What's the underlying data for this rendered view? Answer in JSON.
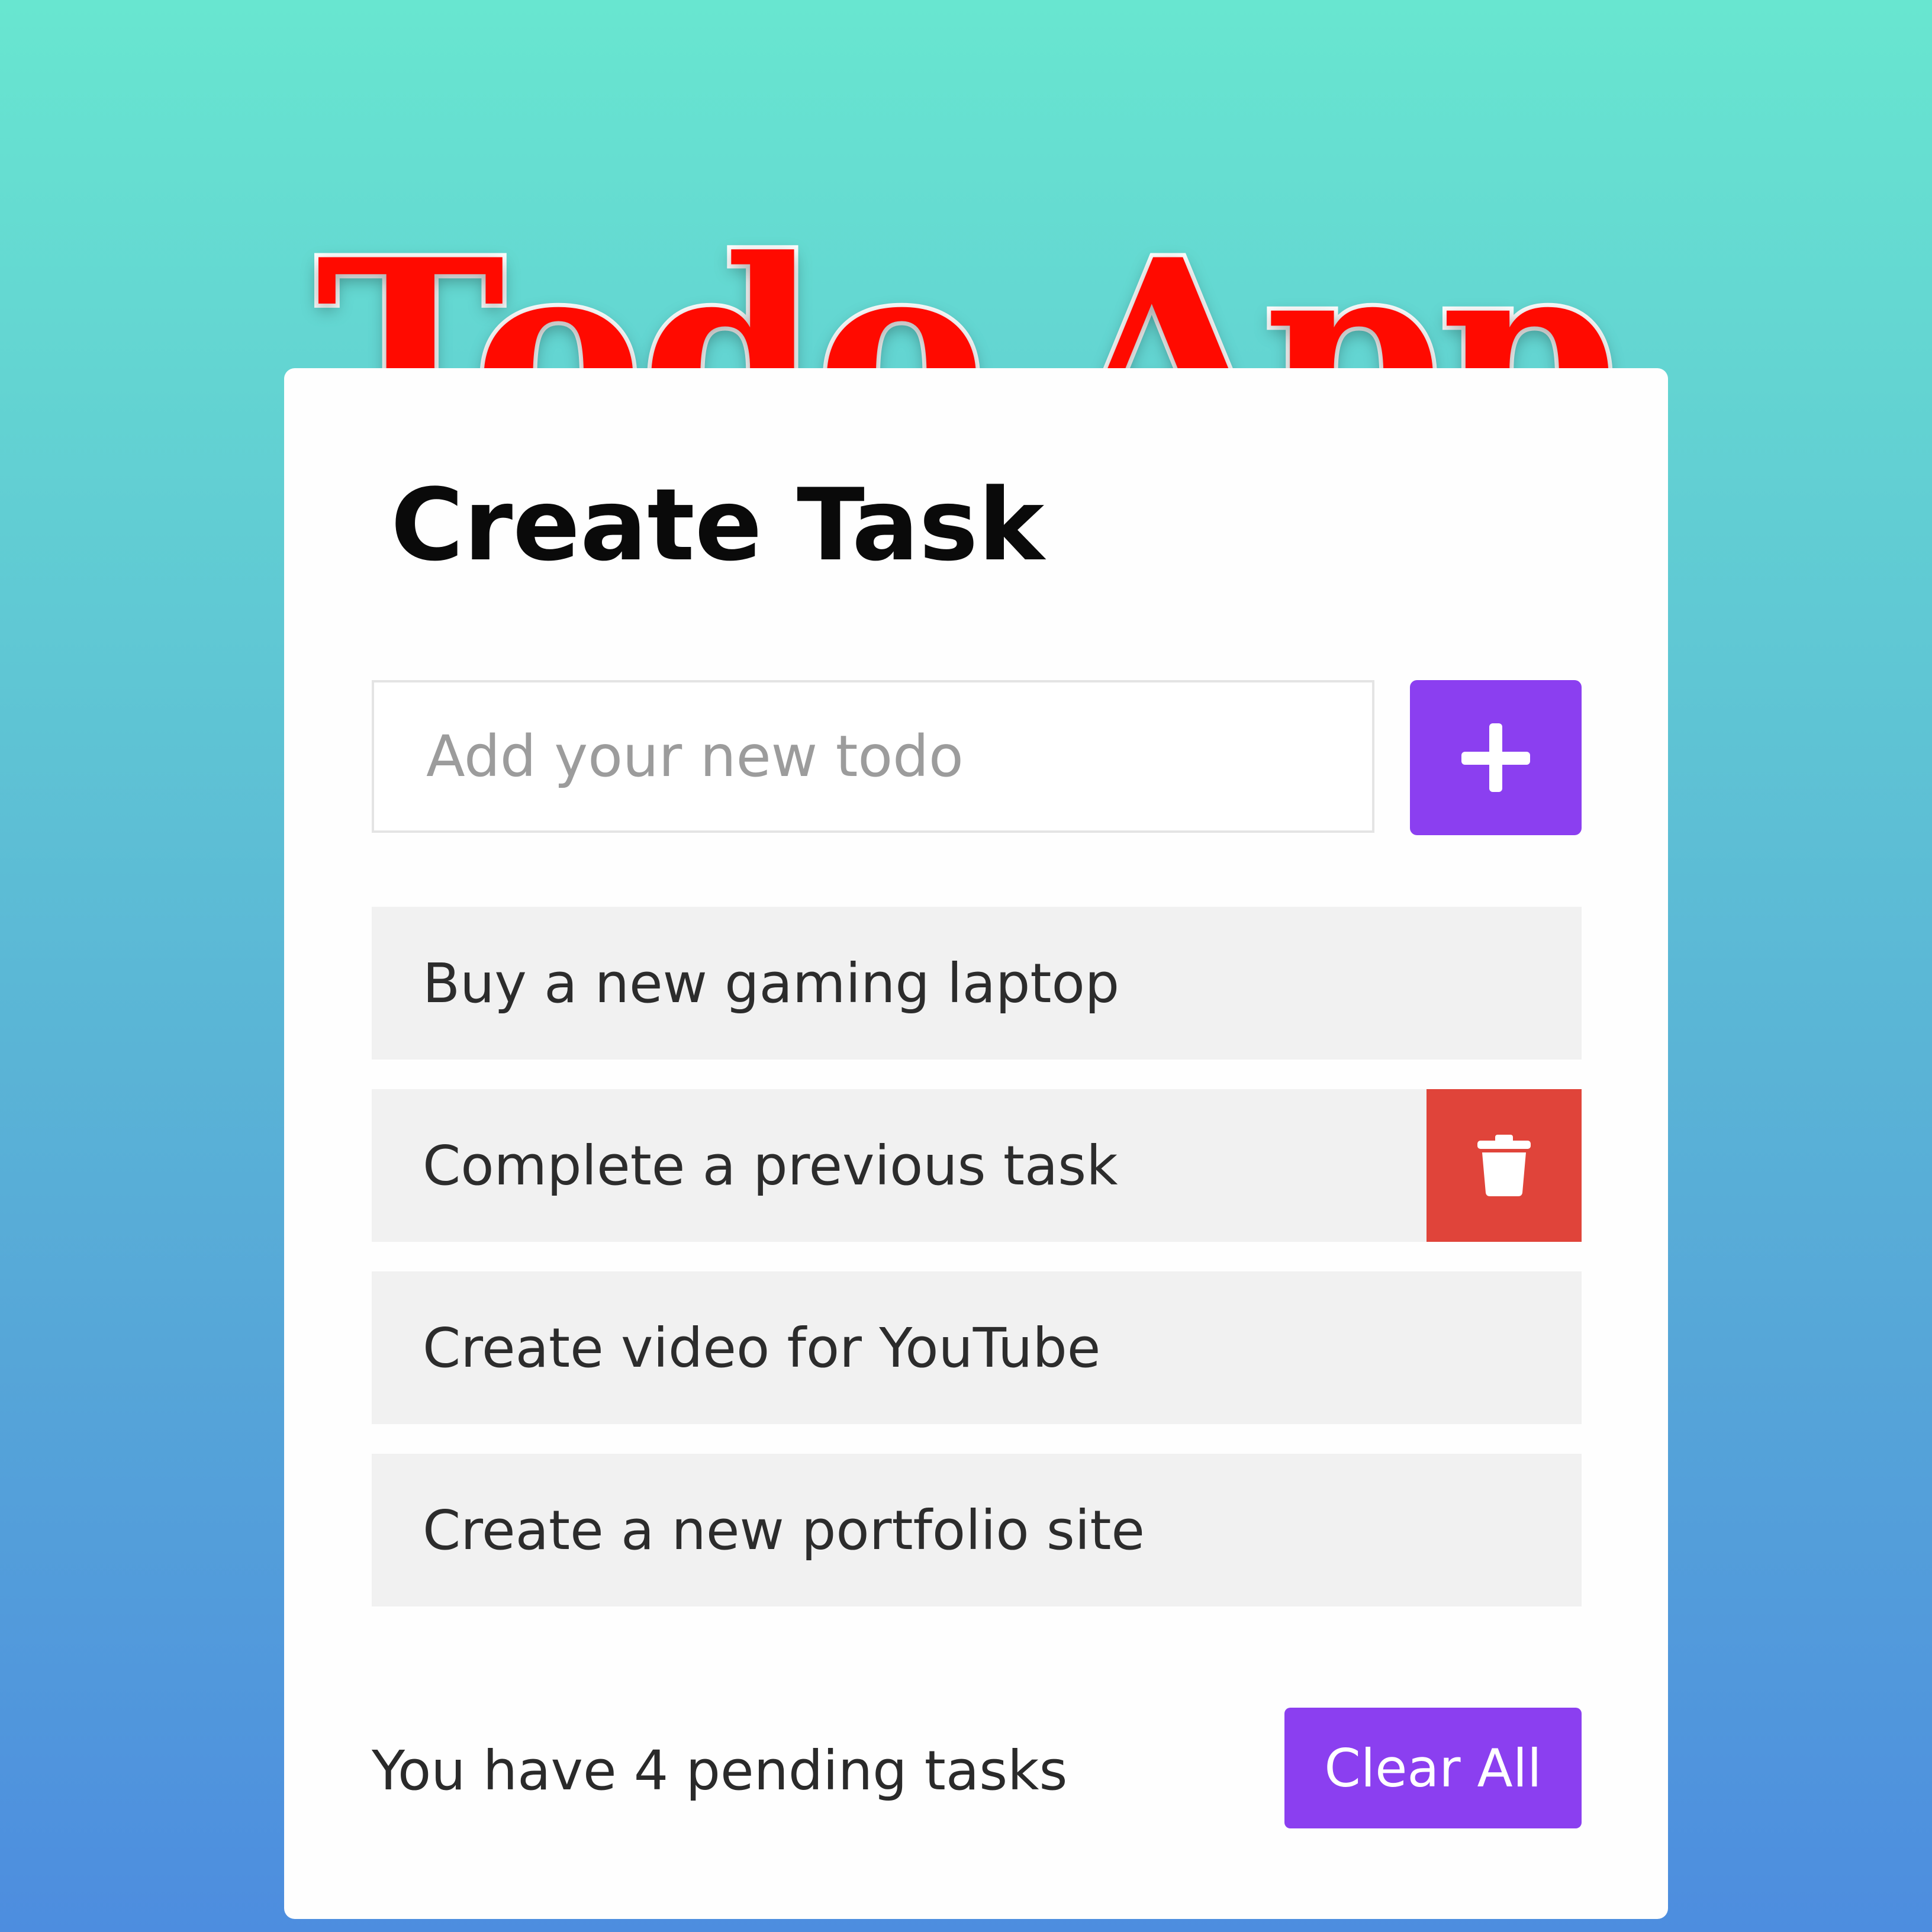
{
  "app_title": "Todo App",
  "card": {
    "title": "Create Task",
    "input": {
      "placeholder": "Add your new todo",
      "value": ""
    },
    "add_button": {
      "icon": "plus-icon"
    },
    "todos": [
      {
        "text": "Buy a new gaming laptop",
        "delete_visible": false
      },
      {
        "text": "Complete a previous task",
        "delete_visible": true
      },
      {
        "text": "Create video for YouTube",
        "delete_visible": false
      },
      {
        "text": "Create a new portfolio site",
        "delete_visible": false
      }
    ],
    "delete_button": {
      "icon": "trash-icon"
    },
    "footer": {
      "pending_text": "You have 4 pending tasks",
      "clear_label": "Clear All"
    }
  },
  "colors": {
    "title_red": "#ff0a00",
    "accent_purple": "#8b3ff0",
    "delete_red": "#e0443a",
    "item_bg": "#f1f1f1",
    "background_top": "#68e6d0",
    "background_bottom": "#4d8ddf"
  }
}
